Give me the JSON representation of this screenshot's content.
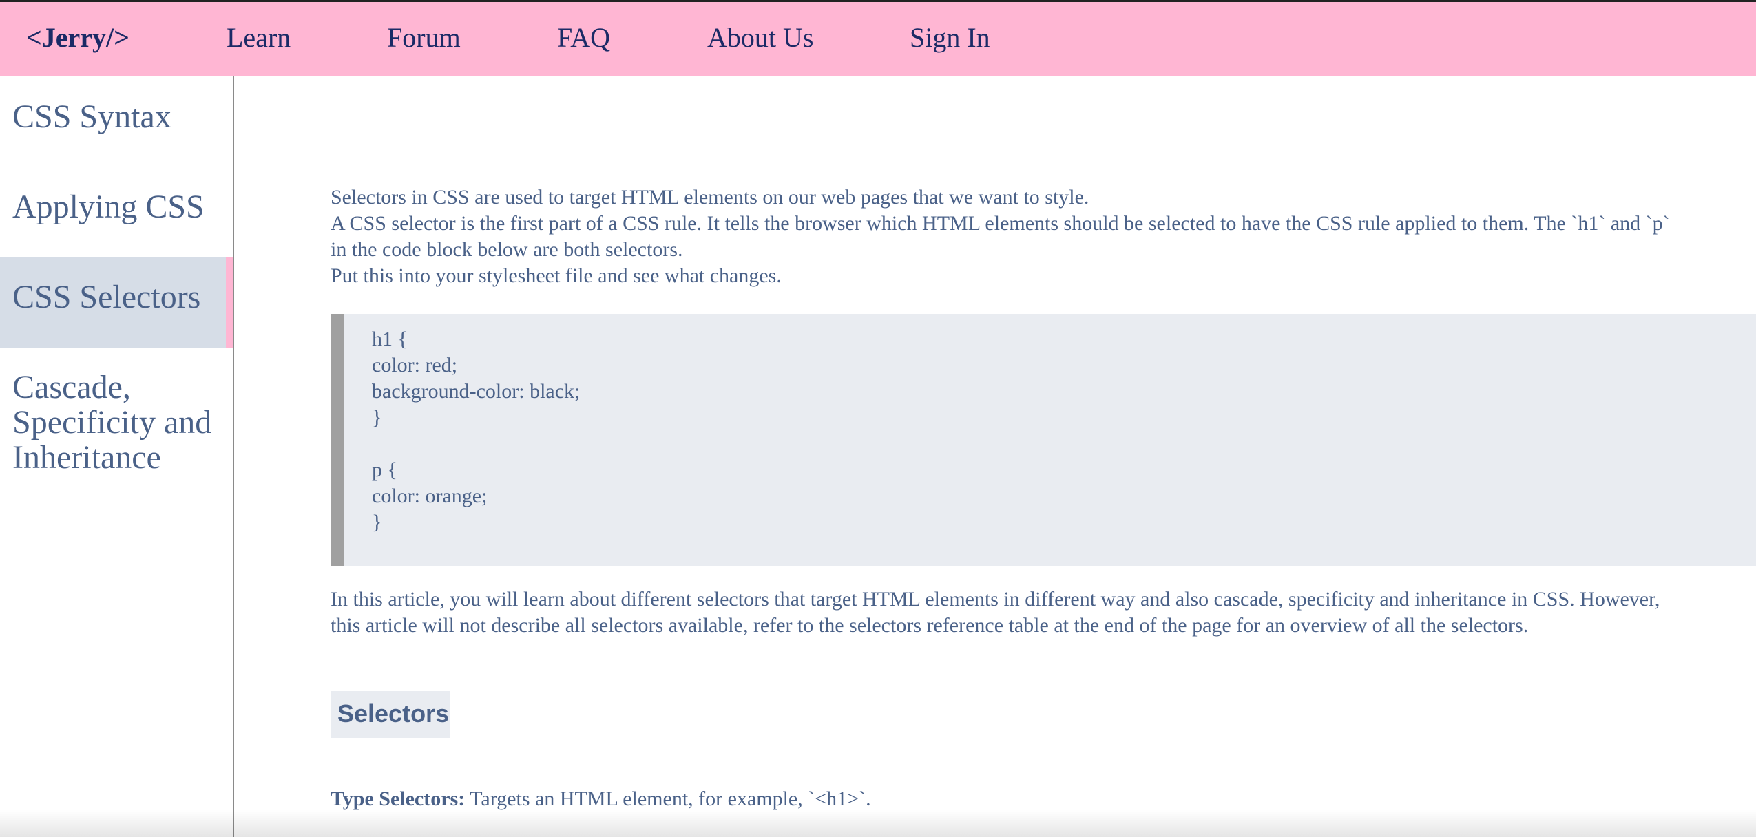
{
  "nav": {
    "logo": "<Jerry/>",
    "links": [
      "Learn",
      "Forum",
      "FAQ",
      "About Us",
      "Sign In"
    ]
  },
  "sidebar": {
    "items": [
      {
        "label": "CSS Syntax"
      },
      {
        "label": "Applying CSS"
      },
      {
        "label": "CSS Selectors",
        "active": true
      },
      {
        "label": "Cascade, Specificity and Inheritance"
      }
    ]
  },
  "main": {
    "intro": [
      "Selectors in CSS are used to target HTML elements on our web pages that we want to style.",
      "A CSS selector is the first part of a CSS rule. It tells the browser which HTML elements should be selected to have the CSS rule applied to them. The `h1` and `p`",
      "in the code block below are both selectors.",
      "Put this into your stylesheet file and see what changes."
    ],
    "code": [
      "h1 {",
      "color: red;",
      "background-color: black;",
      "}",
      "",
      "p {",
      "color: orange;",
      "}"
    ],
    "article": [
      "In this article, you will learn about different selectors that target HTML elements in different way and also cascade, specificity and inheritance in CSS. However,",
      "this article will not describe all selectors available, refer to the selectors reference table at the end of the page for an overview of all the selectors."
    ],
    "section_heading": "Selectors",
    "type_selectors": {
      "label": "Type Selectors:",
      "text": " Targets an HTML element, for example, `<h1>`."
    }
  },
  "colors": {
    "nav_bg": "#ffb6d3",
    "nav_text": "#1b2a66",
    "body_text": "#4a6188",
    "active_bg": "#d6dde7",
    "code_bg": "#e9ecf1",
    "code_border": "#a0a0a0"
  }
}
